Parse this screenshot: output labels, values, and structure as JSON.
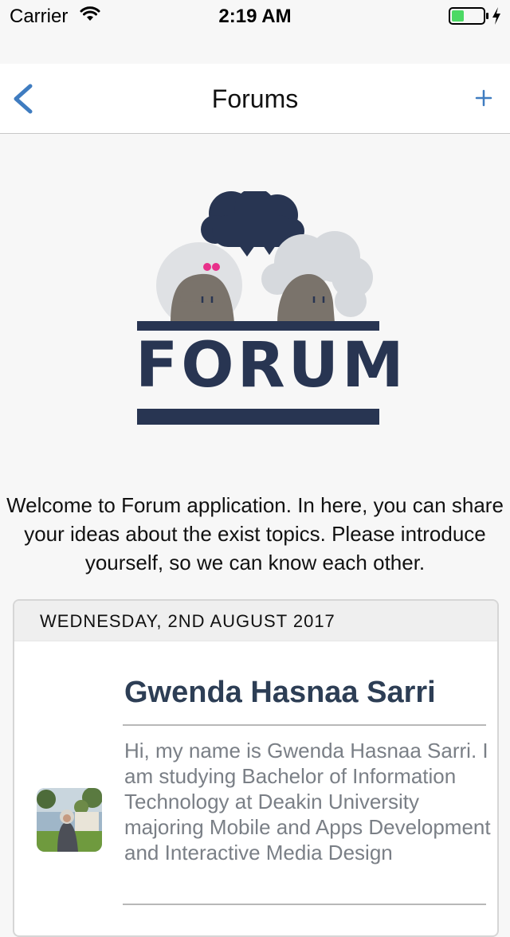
{
  "status_bar": {
    "carrier": "Carrier",
    "time": "2:19 AM"
  },
  "nav": {
    "title": "Forums",
    "back_icon": "chevron-left-icon",
    "add_icon": "plus-icon",
    "accent_color": "#3f7cc0"
  },
  "logo": {
    "text": "FORUM",
    "navy_color": "#283552"
  },
  "welcome_text": "Welcome to Forum application. In here, you can share your ideas about the exist topics. Please introduce yourself, so we can know each other.",
  "post": {
    "date": "WEDNESDAY, 2ND AUGUST 2017",
    "author": "Gwenda Hasnaa Sarri",
    "message": "Hi, my name is Gwenda Hasnaa Sarri. I am studying Bachelor of Information Technology at Deakin University majoring Mobile and Apps Development and Interactive Media Design"
  }
}
